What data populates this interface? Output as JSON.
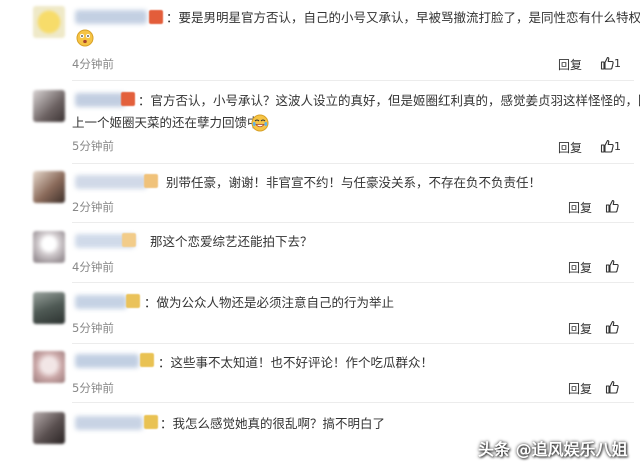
{
  "comments": [
    {
      "text": "：要是男明星官方否认，自己的小号又承认，早被骂撤流打脸了，是同性恋有什么特权吗？",
      "time": "4分钟前",
      "reply": "回复",
      "likes": "1",
      "avatar_color": "#f1d56b",
      "name_color": "#b9c8de",
      "badge_color": "#e35d3a"
    },
    {
      "text": "：官方否认，小号承认？这波人设立的真好，但是姬圈红利真的，感觉姜贞羽这样怪怪的，因为",
      "text_line2": "上一个姬圈天菜的还在孽力回馈中",
      "time": "5分钟前",
      "reply": "回复",
      "likes": "1",
      "avatar_color": "#7a7070",
      "name_color": "#b8c6dc",
      "badge_color": "#e3603c"
    },
    {
      "text": "别带任豪，谢谢！非官宣不约！与任豪没关系，不存在负不负责任！",
      "time": "2分钟前",
      "reply": "回复",
      "avatar_color": "#8a6a5a",
      "name_color": "#c9d3e4",
      "badge_color": "#f0c27a"
    },
    {
      "text": "那这个恋爱综艺还能拍下去？",
      "time": "4分钟前",
      "reply": "回复",
      "avatar_color": "#b9b4b8",
      "name_color": "#c8d4e6",
      "badge_color": "#f2cc8a"
    },
    {
      "text": "：做为公众人物还是必须注意自己的行为举止",
      "time": "5分钟前",
      "reply": "回复",
      "avatar_color": "#4f5a55",
      "name_color": "#bccbe0",
      "badge_color": "#eac25a"
    },
    {
      "text": "：这些事不太知道！也不好评论！作个吃瓜群众！",
      "time": "5分钟前",
      "reply": "回复",
      "avatar_color": "#c9a6a6",
      "name_color": "#b7c7de",
      "badge_color": "#e9c253"
    },
    {
      "text": "：我怎么感觉她真的很乱啊？搞不明白了",
      "time": "",
      "reply": "",
      "avatar_color": "#5a5050",
      "name_color": "#bfcce0",
      "badge_color": "#e9c253"
    }
  ],
  "watermark": "头条 @追风娱乐八姐",
  "colors": {
    "text": "#333333",
    "muted": "#888888",
    "divider": "#ececec"
  }
}
